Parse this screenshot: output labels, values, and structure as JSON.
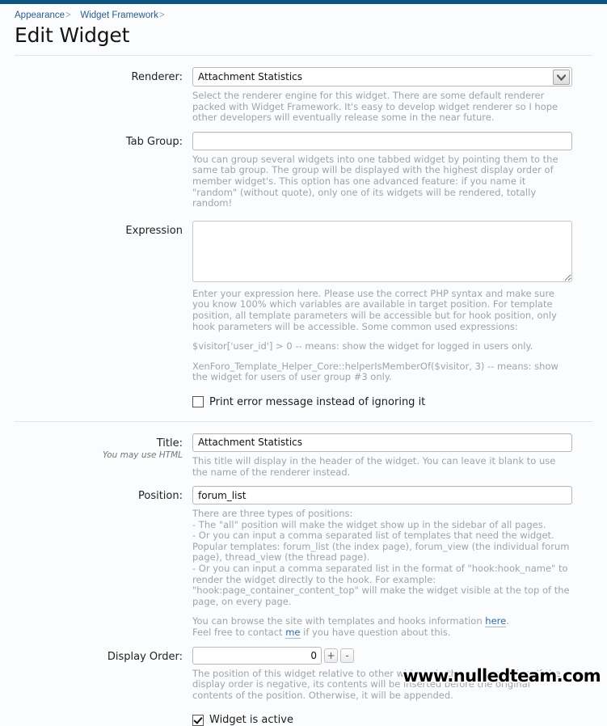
{
  "breadcrumb": {
    "items": [
      {
        "label": "Appearance",
        "sep": ">"
      },
      {
        "label": "Widget Framework",
        "sep": ">"
      }
    ]
  },
  "page_title": "Edit Widget",
  "theme": {
    "topbar_color": "#0f5582",
    "background": "#fbfcfd",
    "hint_text_color": "#a0a3a8",
    "link_color": "#2f6ba5"
  },
  "fields": {
    "renderer": {
      "label": "Renderer:",
      "value": "Attachment Statistics",
      "options": [
        "Attachment Statistics"
      ],
      "hint": "Select the renderer engine for this widget. There are some default renderer packed with Widget Framework. It's easy to develop widget renderer so I hope other developers will eventually release some in the near future."
    },
    "tab_group": {
      "label": "Tab Group:",
      "value": "",
      "placeholder": "",
      "hint": "You can group several widgets into one tabbed widget by pointing them to the same tab group. The group will be displayed with the highest display order of member widget's. This option has one advanced feature: if you name it \"random\" (without quote), only one of its widgets will be rendered, totally random!"
    },
    "expression": {
      "label": "Expression",
      "value": "",
      "placeholder": "",
      "hint_1": "Enter your expression here. Please use the correct PHP syntax and make sure you know 100% which variables are available in target position. For template position, all template parameters will be accessible but for hook position, only hook parameters will be accessible. Some common used expressions:",
      "hint_2": "$visitor['user_id'] > 0 -- means: show the widget for logged in users only.",
      "hint_3": "XenForo_Template_Helper_Core::helperIsMemberOf($visitor, 3) -- means: show the widget for users of user group #3 only.",
      "checkbox_label": "Print error message instead of ignoring it",
      "checkbox_checked": false
    },
    "title": {
      "label": "Title:",
      "sub_hint": "You may use HTML",
      "value": "Attachment Statistics",
      "hint": "This title will display in the header of the widget. You can leave it blank to use the name of the renderer instead."
    },
    "position": {
      "label": "Position:",
      "value": "forum_list",
      "hint_lines": [
        "There are three types of positions:",
        "- The \"all\" position will make the widget show up in the sidebar of all pages.",
        "- Or you can input a comma separated list of templates that need the widget. Popular templates: forum_list (the index page), forum_view (the individual forum page), thread_view (the thread page).",
        "- Or you can input a comma separated list in the format of \"hook:hook_name\" to render the widget directly to the hook. For example: \"hook:page_container_content_top\" will make the widget visible at the top of the page, on every page."
      ],
      "link_line_1_pre": "You can browse the site with templates and hooks information ",
      "link_line_1_link": "here",
      "link_line_1_post": ".",
      "link_line_2_pre": "Feel free to contact ",
      "link_line_2_link": "me",
      "link_line_2_post": " if you have question about this."
    },
    "display_order": {
      "label": "Display Order:",
      "value": "0",
      "increment_label": "+",
      "decrement_label": "-",
      "hint": "The position of this widget relative to other widgets in the same position. If the display order is negative, its contents will be inserted before the original contents of the position. Otherwise, it will be appended."
    },
    "widget_active": {
      "label": "Widget is active",
      "checked": true
    }
  },
  "watermark": "www.nulledteam.com"
}
